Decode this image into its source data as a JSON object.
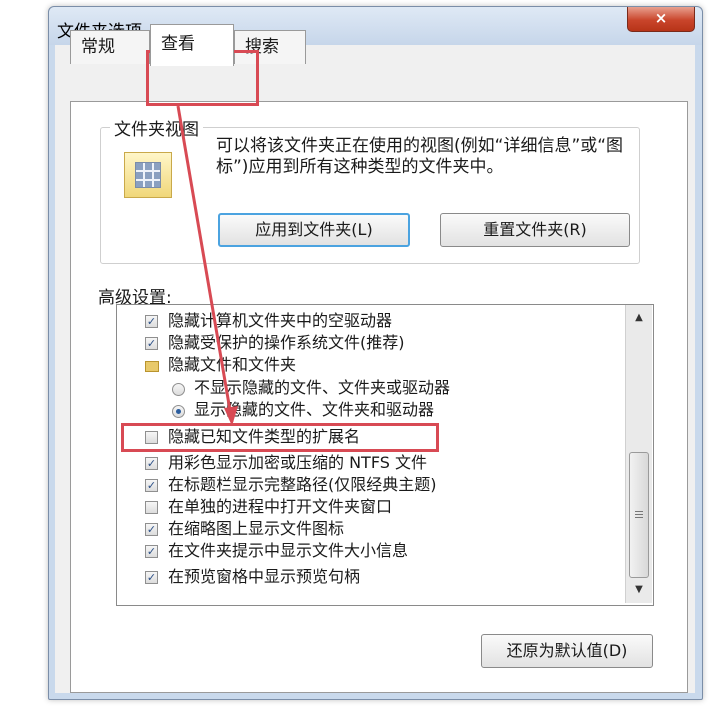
{
  "window": {
    "title": "文件夹选项",
    "close_glyph": "×"
  },
  "tabs": [
    {
      "label": "常规"
    },
    {
      "label": "查看"
    },
    {
      "label": "搜索"
    }
  ],
  "folder_views": {
    "group_label": "文件夹视图",
    "description": "可以将该文件夹正在使用的视图(例如“详细信息”或“图标”)应用到所有这种类型的文件夹中。",
    "apply_button": "应用到文件夹(L)",
    "reset_button": "重置文件夹(R)"
  },
  "advanced": {
    "label": "高级设置:",
    "items": [
      {
        "type": "checkbox",
        "checked": true,
        "label": "隐藏计算机文件夹中的空驱动器"
      },
      {
        "type": "checkbox",
        "checked": true,
        "label": "隐藏受保护的操作系统文件(推荐)"
      },
      {
        "type": "folder",
        "label": "隐藏文件和文件夹"
      },
      {
        "type": "radio",
        "selected": false,
        "label": "不显示隐藏的文件、文件夹或驱动器"
      },
      {
        "type": "radio",
        "selected": true,
        "label": "显示隐藏的文件、文件夹和驱动器"
      },
      {
        "type": "checkbox",
        "checked": false,
        "label": "隐藏已知文件类型的扩展名"
      },
      {
        "type": "checkbox",
        "checked": true,
        "label": "用彩色显示加密或压缩的 NTFS 文件"
      },
      {
        "type": "checkbox",
        "checked": true,
        "label": "在标题栏显示完整路径(仅限经典主题)"
      },
      {
        "type": "checkbox",
        "checked": false,
        "label": "在单独的进程中打开文件夹窗口"
      },
      {
        "type": "checkbox",
        "checked": true,
        "label": "在缩略图上显示文件图标"
      },
      {
        "type": "checkbox",
        "checked": true,
        "label": "在文件夹提示中显示文件大小信息"
      },
      {
        "type": "checkbox",
        "checked": true,
        "label": "在预览窗格中显示预览句柄"
      }
    ],
    "restore_button": "还原为默认值(D)"
  },
  "colors": {
    "highlight": "#d84a54",
    "focus": "#4ba3e0"
  },
  "icons": {
    "check": "✓",
    "scroll_up": "▲",
    "scroll_down": "▼"
  }
}
